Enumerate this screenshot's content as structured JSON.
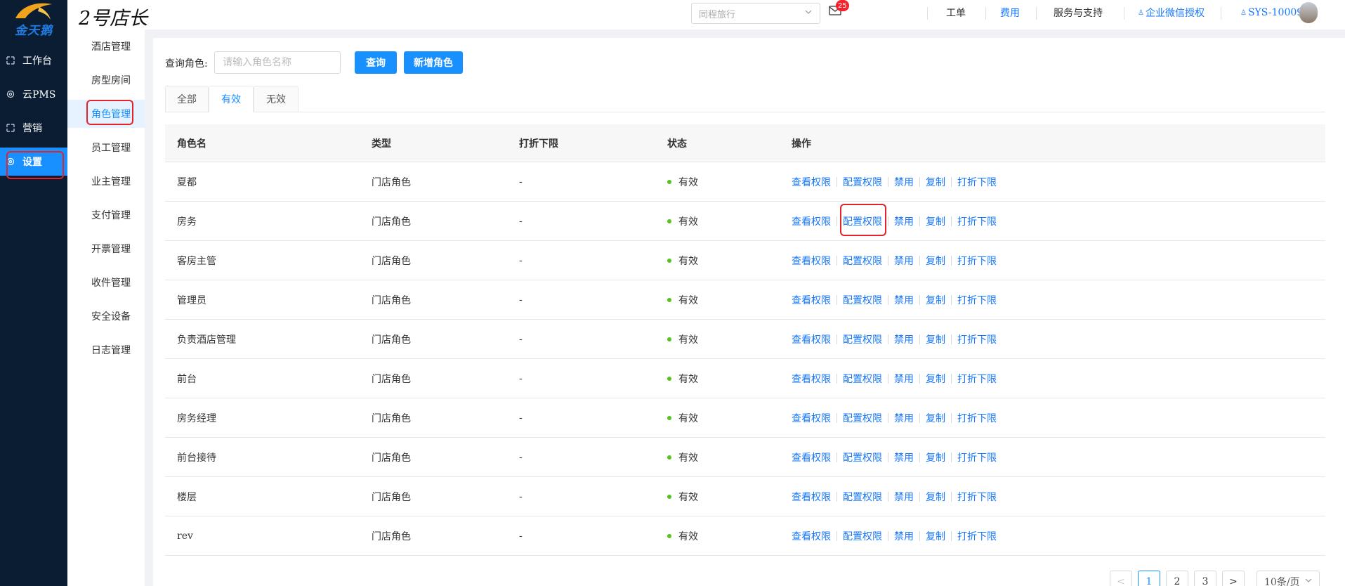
{
  "brand": {
    "logo_text": "金天鹅",
    "store_name": "2号店长"
  },
  "rail": [
    {
      "label": "工作台",
      "icon": "workbench-icon"
    },
    {
      "label": "云PMS",
      "icon": "gear-icon"
    },
    {
      "label": "营销",
      "icon": "marketing-icon"
    },
    {
      "label": "设置",
      "icon": "settings-icon",
      "active": true
    }
  ],
  "submenu": [
    "酒店管理",
    "房型房间",
    "角色管理",
    "员工管理",
    "业主管理",
    "支付管理",
    "开票管理",
    "收件管理",
    "安全设备",
    "日志管理"
  ],
  "submenu_active": "角色管理",
  "header": {
    "channel_select": "同程旅行",
    "mail_badge": "25",
    "nav": [
      "工单",
      "费用",
      "服务与支持",
      "企业微信授权",
      "SYS-10009"
    ]
  },
  "search": {
    "label": "查询角色:",
    "placeholder": "请输入角色名称",
    "query_btn": "查询",
    "add_btn": "新增角色"
  },
  "tabs": [
    "全部",
    "有效",
    "无效"
  ],
  "active_tab": "有效",
  "table": {
    "columns": [
      "角色名",
      "类型",
      "打折下限",
      "状态",
      "操作"
    ],
    "rows": [
      {
        "name": "夏都",
        "type": "门店角色",
        "discount": "-",
        "status": "有效"
      },
      {
        "name": "房务",
        "type": "门店角色",
        "discount": "-",
        "status": "有效"
      },
      {
        "name": "客房主管",
        "type": "门店角色",
        "discount": "-",
        "status": "有效"
      },
      {
        "name": "管理员",
        "type": "门店角色",
        "discount": "-",
        "status": "有效"
      },
      {
        "name": "负责酒店管理",
        "type": "门店角色",
        "discount": "-",
        "status": "有效"
      },
      {
        "name": "前台",
        "type": "门店角色",
        "discount": "-",
        "status": "有效"
      },
      {
        "name": "房务经理",
        "type": "门店角色",
        "discount": "-",
        "status": "有效"
      },
      {
        "name": "前台接待",
        "type": "门店角色",
        "discount": "-",
        "status": "有效"
      },
      {
        "name": "楼层",
        "type": "门店角色",
        "discount": "-",
        "status": "有效"
      },
      {
        "name": "rev",
        "type": "门店角色",
        "discount": "-",
        "status": "有效"
      }
    ],
    "actions": [
      "查看权限",
      "配置权限",
      "禁用",
      "复制",
      "打折下限"
    ]
  },
  "pagination": {
    "prev": "<",
    "pages": [
      "1",
      "2",
      "3"
    ],
    "next": ">",
    "current": "1",
    "page_size": "10条/页"
  },
  "colors": {
    "primary": "#1890ff",
    "rail_bg": "#0b1d33",
    "highlight": "#e0242a",
    "status_ok": "#52c41a"
  }
}
